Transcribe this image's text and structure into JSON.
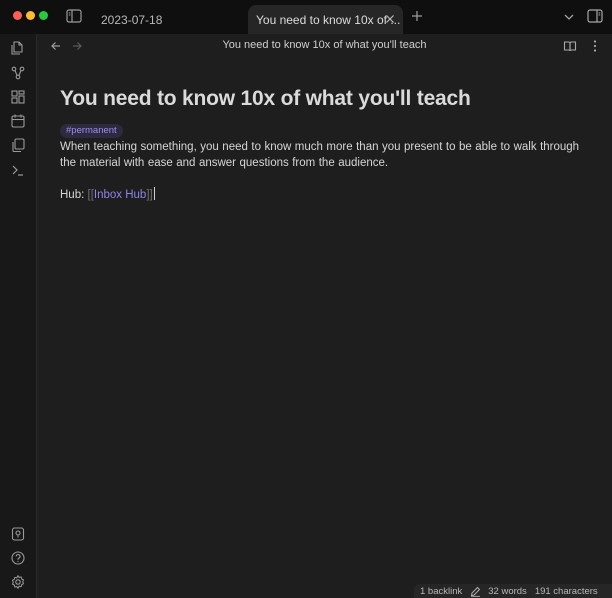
{
  "tabs": {
    "inactive_label": "2023-07-18",
    "active_label": "You need to know 10x of ..."
  },
  "view": {
    "header_title": "You need to know 10x of what you'll teach"
  },
  "note": {
    "title": "You need to know 10x of what you'll teach",
    "tag": "#permanent",
    "body": "When teaching something, you need to know much more than you present to be able to walk through the material with ease and answer questions from the audience.",
    "hub_label": "Hub: ",
    "hub_link_open": "[[",
    "hub_link_text": "Inbox Hub",
    "hub_link_close": "]]"
  },
  "status_bar": {
    "backlinks": "1 backlink",
    "words": "32 words",
    "characters": "191 characters"
  },
  "icons": {
    "ribbon_top": [
      "file-explorer-icon",
      "graph-view-icon",
      "canvas-icon",
      "daily-note-icon",
      "templates-icon",
      "command-palette-icon"
    ],
    "ribbon_bottom": [
      "vault-switcher-icon",
      "help-icon",
      "settings-icon"
    ]
  },
  "colors": {
    "accent": "#8f83e8",
    "tag_text": "#9d8cf0",
    "tag_bg": "#2d2a3f",
    "background": "#1e1e1e",
    "ribbon": "#181818",
    "titlebar": "#0f0f0f"
  }
}
